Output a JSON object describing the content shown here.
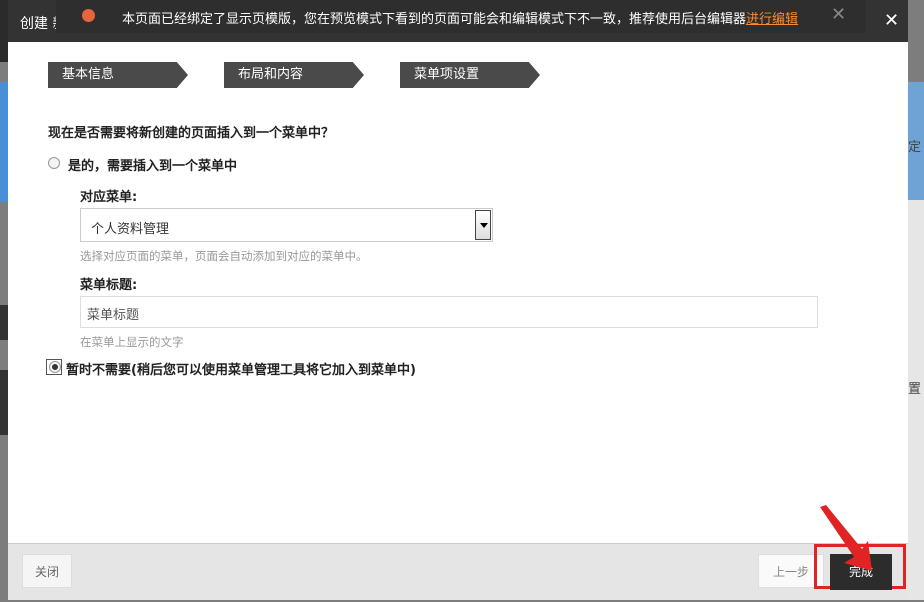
{
  "modal": {
    "title": "创建 新 页 面",
    "close_icon": "close-icon"
  },
  "notice": {
    "text": "本页面已经绑定了显示页模版，您在预览模式下看到的页面可能会和编辑模式下不一致，推荐使用后台编辑器",
    "link": "进行编辑",
    "close_glyph": "✕",
    "dot_color": "#e8643c"
  },
  "steps": [
    {
      "label": "基本信息"
    },
    {
      "label": "布局和内容"
    },
    {
      "label": "菜单项设置"
    }
  ],
  "form": {
    "question": "现在是否需要将新创建的页面插入到一个菜单中？",
    "option_yes": "是的，需要插入到一个菜单中",
    "menu_label": "对应菜单:",
    "menu_value": "个人资料管理",
    "menu_help": "选择对应页面的菜单，页面会自动添加到对应的菜单中。",
    "title_label": "菜单标题:",
    "title_value": "菜单标题",
    "title_help": "在菜单上显示的文字",
    "option_no": "暂时不需要(稍后您可以使用菜单管理工具将它加入到菜单中)",
    "selected_option": "no"
  },
  "footer": {
    "close_label": "关闭",
    "prev_label": "上一步",
    "finish_label": "完成",
    "highlight_color": "#e02424"
  },
  "background": {
    "fragment_1": "定",
    "fragment_2": "置"
  }
}
